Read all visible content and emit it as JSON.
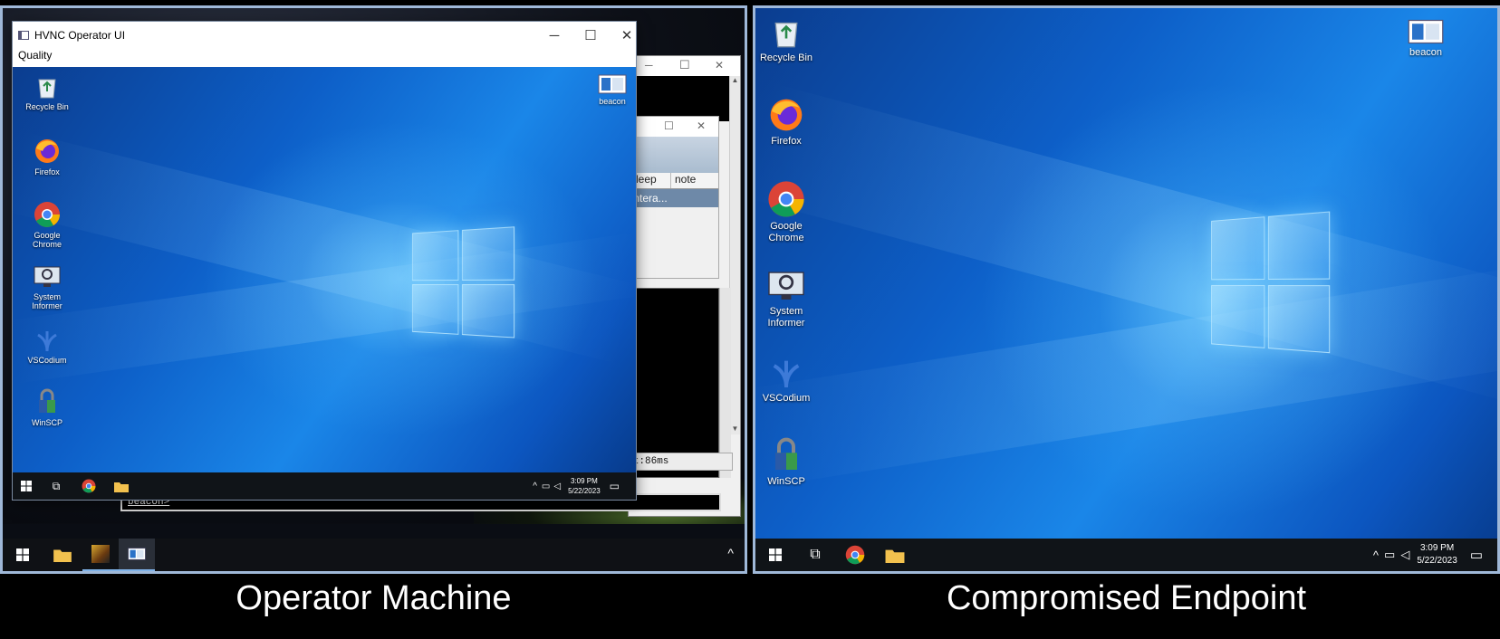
{
  "colors": {
    "accent": "#9fb8d8",
    "taskbar": "#101418",
    "wallpaper": "#0d5fc8"
  },
  "captions": {
    "left": "Operator Machine",
    "right": "Compromised Endpoint"
  },
  "hvnc": {
    "title": "HVNC Operator UI",
    "menu": "Quality",
    "controls": {
      "minimize": "─",
      "maximize": "☐",
      "close": "✕"
    }
  },
  "bg_app": {
    "controls": {
      "minimize": "─",
      "maximize": "☐",
      "close": "✕"
    },
    "columns": [
      "sleep",
      "note"
    ],
    "row": "Intera...",
    "console_prompt": "beacon>",
    "status": "last:86ms"
  },
  "desktop_icons": [
    {
      "label": "Recycle Bin",
      "icon": "recycle-bin-icon"
    },
    {
      "label": "Firefox",
      "icon": "firefox-icon"
    },
    {
      "label": "Google Chrome",
      "icon": "chrome-icon"
    },
    {
      "label": "System Informer",
      "icon": "system-informer-icon"
    },
    {
      "label": "VSCodium",
      "icon": "vscodium-icon"
    },
    {
      "label": "WinSCP",
      "icon": "winscp-icon"
    }
  ],
  "beacon_icon": {
    "label": "beacon",
    "icon": "beacon-icon"
  },
  "tray": {
    "time": "3:09 PM",
    "date": "5/22/2023"
  }
}
